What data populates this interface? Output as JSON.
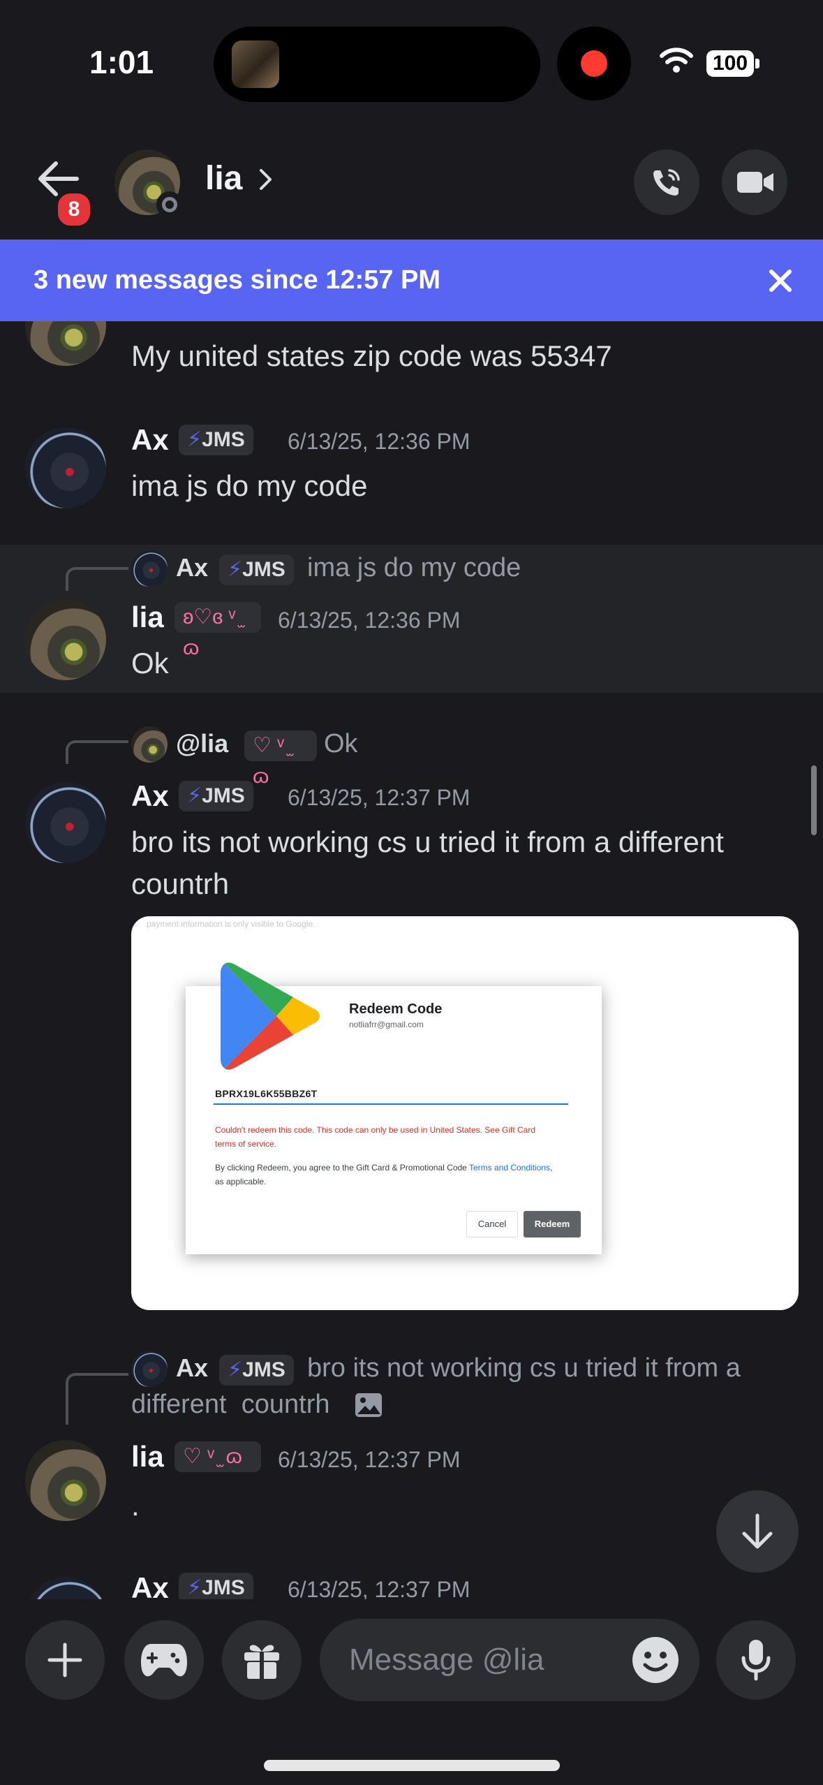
{
  "status_bar": {
    "time": "1:01",
    "battery": "100"
  },
  "header": {
    "unread_count": "8",
    "contact_name": "lia"
  },
  "banner": {
    "text": "3 new messages since 12:57 PM"
  },
  "messages": [
    {
      "text": "My united states zip code was 55347"
    },
    {
      "author": "Ax",
      "tag": "JMS",
      "timestamp": "6/13/25, 12:36 PM",
      "text": "ima js do my code"
    },
    {
      "reply": {
        "author": "Ax",
        "tag": "JMS",
        "text": "ima js do my code"
      },
      "author": "lia",
      "tag": "ʚ♡ɞ ᵛ ̫ ɷ",
      "timestamp": "6/13/25, 12:36 PM",
      "text": "Ok"
    },
    {
      "reply": {
        "author": "@lia",
        "tag": "♡ ᵛ ̫ ɷ",
        "text": "Ok"
      },
      "author": "Ax",
      "tag": "JMS",
      "timestamp": "6/13/25, 12:37 PM",
      "text_line1": "bro its not working cs u tried it from a different",
      "text_line2": "countrh"
    },
    {
      "reply": {
        "author": "Ax",
        "tag": "JMS",
        "text_line1": "bro its not working cs u tried it from a",
        "text_line2": "different  countrh"
      },
      "author": "lia",
      "tag": "♡ ᵛ ̫ ɷ",
      "timestamp": "6/13/25, 12:37 PM",
      "text": "."
    },
    {
      "author": "Ax",
      "tag": "JMS",
      "timestamp": "6/13/25, 12:37 PM"
    }
  ],
  "embed": {
    "top_note": "payment information is only visible to Google.",
    "title": "Redeem Code",
    "email": "notliafrr@gmail.com",
    "code": "BPRX19L6K55BBZ6T",
    "error": "Couldn't redeem this code. This code can only be used in United States. See Gift Card terms of service.",
    "terms_prefix": "By clicking Redeem, you agree to the Gift Card & Promotional Code ",
    "terms_link": "Terms and Conditions",
    "terms_suffix": ", as applicable.",
    "cancel_label": "Cancel",
    "redeem_label": "Redeem"
  },
  "composer": {
    "placeholder": "Message @lia"
  },
  "colors": {
    "accent": "#5865f2",
    "background": "#1a1a1e",
    "badge": "#e5343a",
    "record": "#ff3b30"
  }
}
